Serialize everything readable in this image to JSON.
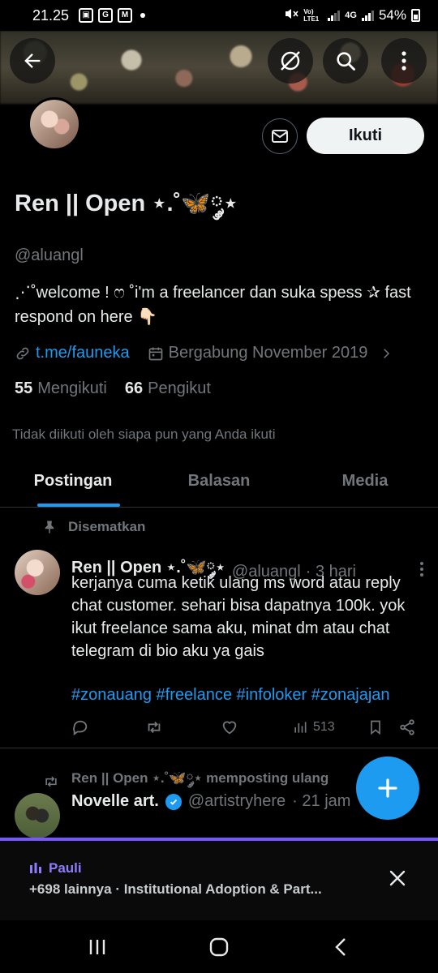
{
  "status_bar": {
    "time": "21.25",
    "network": "4G",
    "volte": "Vo) LTE1",
    "battery": "54%"
  },
  "header": {
    "back_icon": "arrow-left-icon",
    "grok_icon": "grok-icon",
    "search_icon": "search-icon",
    "more_icon": "more-vertical-icon"
  },
  "profile": {
    "display_name": "Ren || Open ⋆.˚🦋༘⋆",
    "handle": "@aluangl",
    "bio": "⋰˚welcome ! ෆ ˚i'm a freelancer dan suka spess ✰ fast respond on here 👇🏻",
    "link": "t.me/fauneka",
    "joined": "Bergabung November 2019",
    "following_count": "55",
    "following_label": "Mengikuti",
    "followers_count": "66",
    "followers_label": "Pengikut",
    "not_followed_text": "Tidak diikuti oleh siapa pun yang Anda ikuti",
    "follow_button": "Ikuti"
  },
  "tabs": [
    {
      "label": "Postingan",
      "active": true
    },
    {
      "label": "Balasan",
      "active": false
    },
    {
      "label": "Media",
      "active": false
    }
  ],
  "pinned_post": {
    "pinned_label": "Disematkan",
    "author": "Ren || Open ⋆.˚🦋༘⋆",
    "handle": "@aluangl",
    "time": "· 3 hari",
    "text": "kerjanya cuma ketik ulang ms word atau reply chat customer. sehari bisa dapatnya 100k. yok ikut freelance sama aku, minat dm atau chat telegram di bio aku ya gais",
    "hashtags": "#zonauang #freelance #infoloker #zonajajan",
    "views": "513"
  },
  "repost": {
    "label": "Ren || Open ⋆.˚🦋༘⋆ memposting ulang",
    "author": "Novelle art.",
    "handle": "@artistryhere",
    "time": "· 21 jam"
  },
  "spaces": {
    "host": "Pauli",
    "subtitle": "+698 lainnya · Institutional Adoption & Part..."
  },
  "colors": {
    "accent": "#1d9bf0",
    "spaces": "#7856ff",
    "muted": "#71767b",
    "text": "#e7e9ea"
  }
}
